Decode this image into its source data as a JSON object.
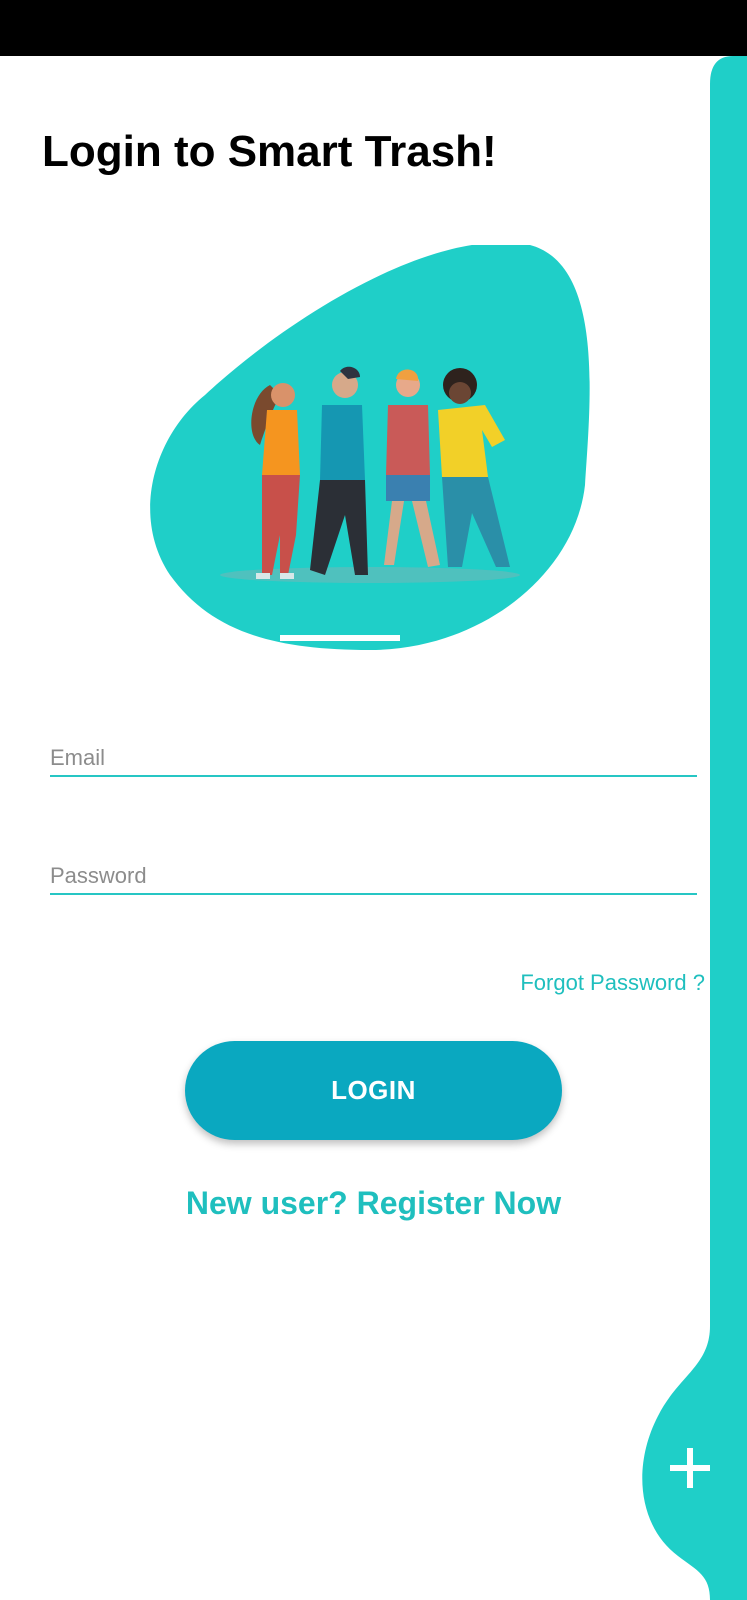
{
  "page": {
    "title": "Login to Smart Trash!"
  },
  "form": {
    "email_placeholder": "Email",
    "password_placeholder": "Password",
    "forgot_label": "Forgot Password ?",
    "login_label": "LOGIN",
    "register_label": "New user? Register Now"
  },
  "icons": {
    "hero": "people-illustration",
    "plus": "plus-icon"
  },
  "colors": {
    "accent": "#1fcfc8",
    "button": "#0aa8c0",
    "link": "#1fbfbe"
  }
}
